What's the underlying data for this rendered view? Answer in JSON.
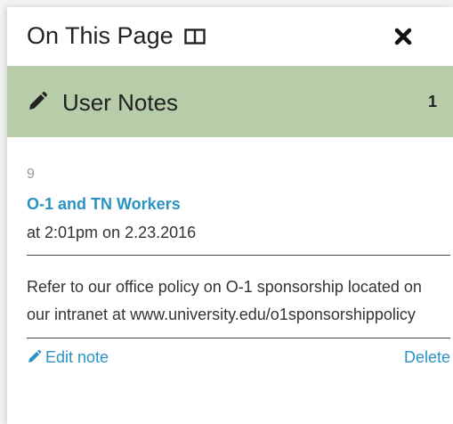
{
  "panel": {
    "title": "On This Page",
    "layout_icon": "layout-split-icon",
    "close_icon": "close-icon"
  },
  "section": {
    "icon": "pencil-icon",
    "label": "User Notes",
    "count": "1",
    "background": "#b7cda9"
  },
  "note": {
    "number": "9",
    "title": "O-1 and TN Workers",
    "timestamp": "at 2:01pm on 2.23.2016",
    "body": "Refer to our office policy on O-1 sponsorship located on our intranet at www.university.edu/o1sponsorshippolicy",
    "edit_label": "Edit note",
    "delete_label": "Delete",
    "link_color": "#2a93c4"
  }
}
